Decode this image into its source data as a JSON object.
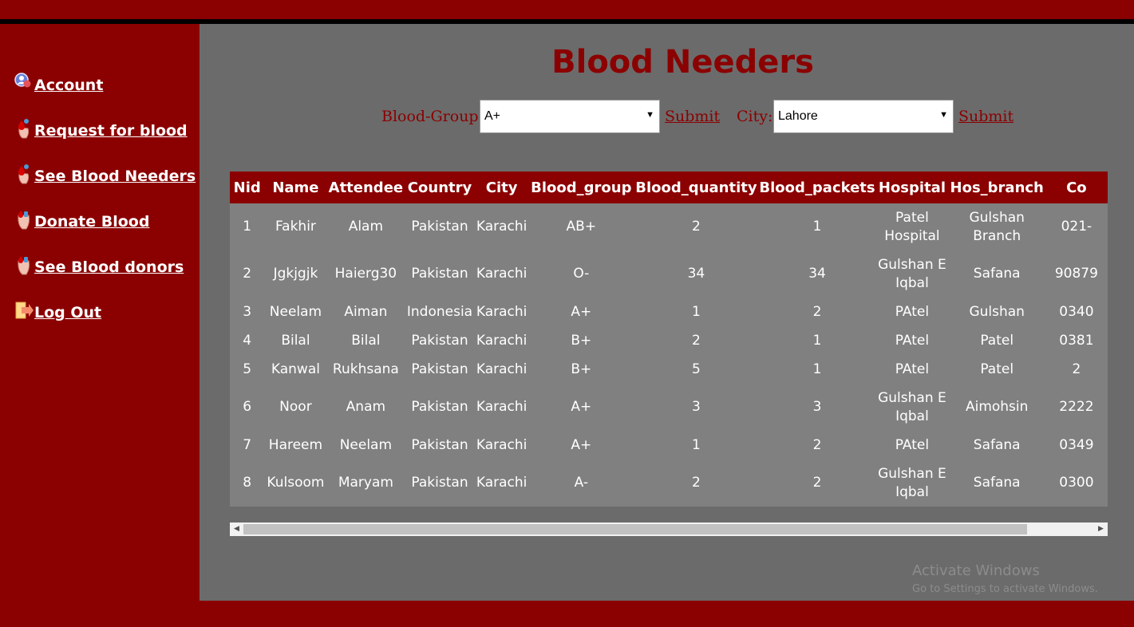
{
  "sidebar": {
    "items": [
      {
        "label": "Account",
        "icon": "user-icon"
      },
      {
        "label": "Request for blood",
        "icon": "blood-drop-hand-icon"
      },
      {
        "label": "See Blood Needers",
        "icon": "blood-drop-hand-icon"
      },
      {
        "label": "Donate Blood",
        "icon": "blood-hand-icon"
      },
      {
        "label": "See Blood donors",
        "icon": "blood-hand-icon"
      },
      {
        "label": "Log Out",
        "icon": "logout-icon"
      }
    ]
  },
  "main": {
    "title": "Blood Needers",
    "filters": {
      "blood_group_label": "Blood-Group :",
      "blood_group_value": "A+",
      "city_label": "City:",
      "city_value": "Lahore",
      "submit_label": "Submit"
    },
    "table": {
      "headers": [
        "Nid",
        "Name",
        "Attendee",
        "Country",
        "City",
        "Blood_group",
        "Blood_quantity",
        "Blood_packets",
        "Hospital",
        "Hos_branch",
        "Co"
      ],
      "rows": [
        [
          "1",
          "Fakhir",
          "Alam",
          "Pakistan",
          "Karachi",
          "AB+",
          "2",
          "1",
          "Patel Hospital",
          "Gulshan Branch",
          "021-"
        ],
        [
          "2",
          "Jgkjgjk",
          "Haierg30",
          "Pakistan",
          "Karachi",
          "O-",
          "34",
          "34",
          "Gulshan E Iqbal",
          "Safana",
          "90879"
        ],
        [
          "3",
          "Neelam",
          "Aiman",
          "Indonesia",
          "Karachi",
          "A+",
          "1",
          "2",
          "PAtel",
          "Gulshan",
          "0340"
        ],
        [
          "4",
          "Bilal",
          "Bilal",
          "Pakistan",
          "Karachi",
          "B+",
          "2",
          "1",
          "PAtel",
          "Patel",
          "0381"
        ],
        [
          "5",
          "Kanwal",
          "Rukhsana",
          "Pakistan",
          "Karachi",
          "B+",
          "5",
          "1",
          "PAtel",
          "Patel",
          "2"
        ],
        [
          "6",
          "Noor",
          "Anam",
          "Pakistan",
          "Karachi",
          "A+",
          "3",
          "3",
          "Gulshan E Iqbal",
          "Aimohsin",
          "2222"
        ],
        [
          "7",
          "Hareem",
          "Neelam",
          "Pakistan",
          "Karachi",
          "A+",
          "1",
          "2",
          "PAtel",
          "Safana",
          "0349"
        ],
        [
          "8",
          "Kulsoom",
          "Maryam",
          "Pakistan",
          "Karachi",
          "A-",
          "2",
          "2",
          "Gulshan E Iqbal",
          "Safana",
          "0300"
        ]
      ]
    }
  },
  "watermark": {
    "line1": "Activate Windows",
    "line2": "Go to Settings to activate Windows."
  },
  "colors": {
    "brand_red": "#8b0000",
    "content_gray": "#6b6b6b",
    "table_gray": "#808080"
  }
}
